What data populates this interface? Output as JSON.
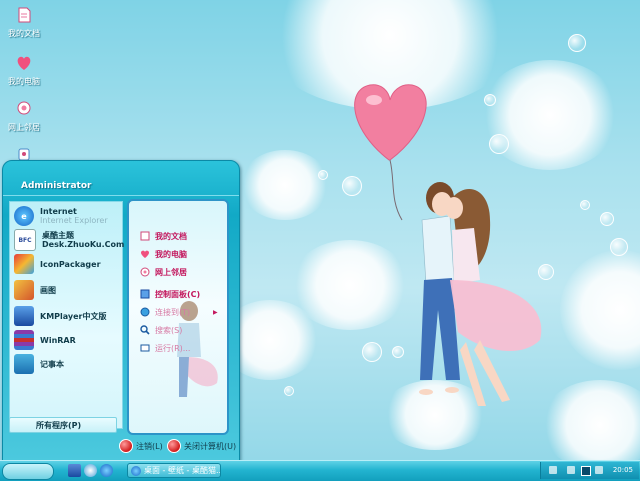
{
  "colors": {
    "accent": "#12a9c6",
    "pink": "#c3185e",
    "sky": "#a9e1ee"
  },
  "desktop": {
    "icons": [
      {
        "label": "我的文档",
        "icon": "documents-icon"
      },
      {
        "label": "我的电脑",
        "icon": "computer-heart-icon"
      },
      {
        "label": "网上邻居",
        "icon": "network-icon"
      },
      {
        "label": "",
        "icon": "recycle-bin-icon"
      }
    ]
  },
  "start_menu": {
    "user": "Administrator",
    "programs": [
      {
        "title": "Internet",
        "subtitle": "Internet Explorer",
        "icon": "ie-icon"
      },
      {
        "title": "桌酷主题",
        "subtitle": "Desk.ZhuoKu.Com",
        "icon": "zhuoku-icon"
      },
      {
        "title": "IconPackager",
        "subtitle": "",
        "icon": "iconpackager-icon"
      },
      {
        "title": "画图",
        "subtitle": "",
        "icon": "paint-icon"
      },
      {
        "title": "KMPlayer中文版",
        "subtitle": "",
        "icon": "kmplayer-icon"
      },
      {
        "title": "WinRAR",
        "subtitle": "",
        "icon": "winrar-icon"
      },
      {
        "title": "记事本",
        "subtitle": "",
        "icon": "notepad-icon"
      }
    ],
    "all_programs": "所有程序(P)",
    "places": [
      {
        "label": "我的文档",
        "icon": "documents-icon"
      },
      {
        "label": "我的电脑",
        "icon": "heart-icon"
      },
      {
        "label": "网上邻居",
        "icon": "network-icon"
      },
      {
        "label": "控制面板(C)",
        "icon": "control-panel-icon"
      },
      {
        "label": "连接到(T)",
        "icon": "globe-icon"
      },
      {
        "label": "搜索(S)",
        "icon": "search-icon"
      },
      {
        "label": "运行(R)...",
        "icon": "run-icon"
      }
    ],
    "logoff": "注销(L)",
    "shutdown": "关闭计算机(U)"
  },
  "taskbar": {
    "window_title": "桌面 - 壁纸 - 桌酷猫...",
    "clock": "20:05"
  }
}
